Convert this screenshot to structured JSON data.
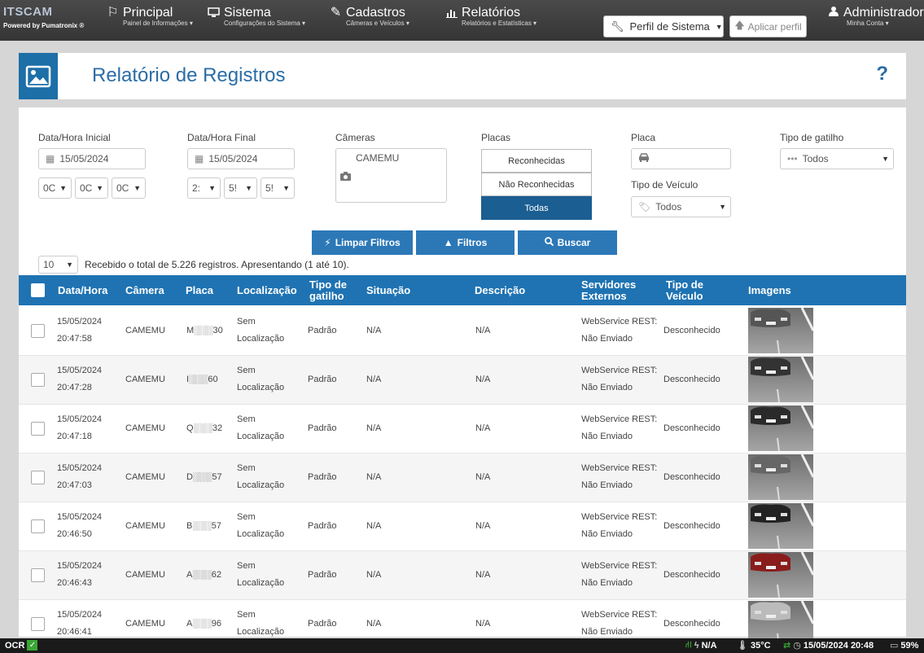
{
  "brand": {
    "name_left": "ITSCAM",
    "name_right": "",
    "powered": "Powered by Pumatronix ®"
  },
  "nav": [
    {
      "label": "Principal",
      "sub": "Painel de Informações ▾",
      "icon": "flag-icon"
    },
    {
      "label": "Sistema",
      "sub": "Configurações do Sistema ▾",
      "icon": "monitor-icon"
    },
    {
      "label": "Cadastros",
      "sub": "Câmeras e Veículos ▾",
      "icon": "edit-icon"
    },
    {
      "label": "Relatórios",
      "sub": "Relatórios e Estatísticas ▾",
      "icon": "bar-chart-icon"
    }
  ],
  "profile": {
    "selected": "Perfil de Sistema",
    "apply": "Aplicar perfil"
  },
  "user": {
    "name": "Administrador",
    "sub": "Minha Conta ▾"
  },
  "page": {
    "title": "Relatório de Registros",
    "help": "?"
  },
  "filters": {
    "start_label": "Data/Hora Inicial",
    "start_date": "15/05/2024",
    "start_h": "0C",
    "start_m": "0C",
    "start_s": "0C",
    "end_label": "Data/Hora Final",
    "end_date": "15/05/2024",
    "end_h": "2:",
    "end_m": "5!",
    "end_s": "5!",
    "cameras_label": "Câmeras",
    "camera_item": "CAMEMU",
    "plates_label": "Placas",
    "plate_options": [
      "Reconhecidas",
      "Não Reconhecidas",
      "Todas"
    ],
    "plate_label": "Placa",
    "vehicle_type_label": "Tipo de Veículo",
    "vehicle_type": "Todos",
    "trigger_label": "Tipo de gatilho",
    "trigger": "Todos"
  },
  "actions": {
    "clear": "Limpar Filtros",
    "filters": "Filtros",
    "search": "Buscar"
  },
  "pagination": {
    "page_size": "10",
    "summary": "Recebido o total de 5.226 registros. Apresentando (1 até 10)."
  },
  "table": {
    "headers": [
      "Data/Hora",
      "Câmera",
      "Placa",
      "Localização",
      "Tipo de gatilho",
      "Situação",
      "Descrição",
      "Servidores Externos",
      "Tipo de Veículo",
      "Imagens"
    ],
    "rows": [
      {
        "date": "15/05/2024",
        "time": "20:47:58",
        "camera": "CAMEMU",
        "plate": "M░░░30",
        "loc1": "Sem",
        "loc2": "Localização",
        "trigger": "Padrão",
        "status": "N/A",
        "desc": "N/A",
        "srv1": "WebService REST:",
        "srv2": "Não Enviado",
        "vtype": "Desconhecido"
      },
      {
        "date": "15/05/2024",
        "time": "20:47:28",
        "camera": "CAMEMU",
        "plate": "I░░░60",
        "loc1": "Sem",
        "loc2": "Localização",
        "trigger": "Padrão",
        "status": "N/A",
        "desc": "N/A",
        "srv1": "WebService REST:",
        "srv2": "Não Enviado",
        "vtype": "Desconhecido"
      },
      {
        "date": "15/05/2024",
        "time": "20:47:18",
        "camera": "CAMEMU",
        "plate": "Q░░░32",
        "loc1": "Sem",
        "loc2": "Localização",
        "trigger": "Padrão",
        "status": "N/A",
        "desc": "N/A",
        "srv1": "WebService REST:",
        "srv2": "Não Enviado",
        "vtype": "Desconhecido"
      },
      {
        "date": "15/05/2024",
        "time": "20:47:03",
        "camera": "CAMEMU",
        "plate": "D░░░57",
        "loc1": "Sem",
        "loc2": "Localização",
        "trigger": "Padrão",
        "status": "N/A",
        "desc": "N/A",
        "srv1": "WebService REST:",
        "srv2": "Não Enviado",
        "vtype": "Desconhecido"
      },
      {
        "date": "15/05/2024",
        "time": "20:46:50",
        "camera": "CAMEMU",
        "plate": "B░░░57",
        "loc1": "Sem",
        "loc2": "Localização",
        "trigger": "Padrão",
        "status": "N/A",
        "desc": "N/A",
        "srv1": "WebService REST:",
        "srv2": "Não Enviado",
        "vtype": "Desconhecido"
      },
      {
        "date": "15/05/2024",
        "time": "20:46:43",
        "camera": "CAMEMU",
        "plate": "A░░░62",
        "loc1": "Sem",
        "loc2": "Localização",
        "trigger": "Padrão",
        "status": "N/A",
        "desc": "N/A",
        "srv1": "WebService REST:",
        "srv2": "Não Enviado",
        "vtype": "Desconhecido"
      },
      {
        "date": "15/05/2024",
        "time": "20:46:41",
        "camera": "CAMEMU",
        "plate": "A░░░96",
        "loc1": "Sem",
        "loc2": "Localização",
        "trigger": "Padrão",
        "status": "N/A",
        "desc": "N/A",
        "srv1": "WebService REST:",
        "srv2": "Não Enviado",
        "vtype": "Desconhecido"
      }
    ]
  },
  "status": {
    "ocr": "OCR",
    "power": "N/A",
    "temp": "35°C",
    "datetime": "15/05/2024 20:48",
    "disk": "59%"
  },
  "colors": {
    "accent": "#1f73b2",
    "active_plate": "#1a5e92",
    "header_bg": "#353535",
    "ok_green": "#3aa635"
  }
}
